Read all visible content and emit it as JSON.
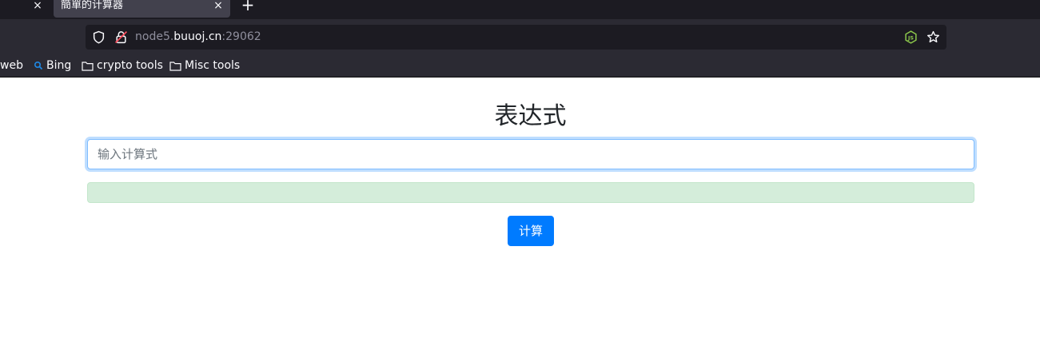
{
  "browser": {
    "tab_title": "簡單的计算器",
    "prev_tab_close": "×",
    "tab_close": "×",
    "new_tab": "+",
    "url": {
      "prefix": "node5.",
      "host": "buuoj.cn",
      "port": ":29062"
    },
    "bookmarks": [
      {
        "label": "web",
        "icon": "none"
      },
      {
        "label": "Bing",
        "icon": "search-icon"
      },
      {
        "label": "crypto tools",
        "icon": "folder-icon"
      },
      {
        "label": "Misc tools",
        "icon": "folder-icon"
      }
    ]
  },
  "page": {
    "title": "表达式",
    "input": {
      "placeholder": "输入计算式",
      "value": ""
    },
    "result": "",
    "button_label": "计算"
  },
  "colors": {
    "primary": "#007bff",
    "success_bg": "#d4edda",
    "chrome_dark": "#1c1b22",
    "chrome_mid": "#2b2a33"
  }
}
